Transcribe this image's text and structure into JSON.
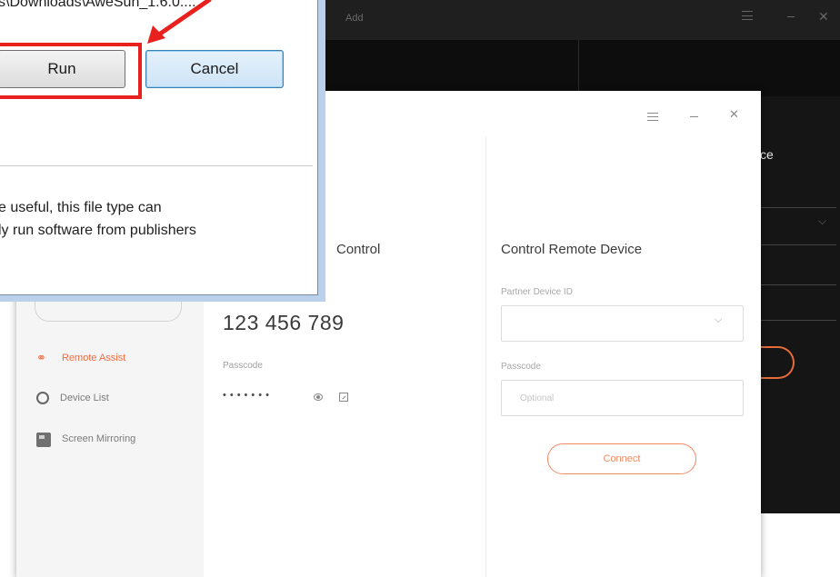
{
  "dark_app": {
    "title": "Add",
    "heading_fragment": "ce"
  },
  "app": {
    "sidebar": {
      "items": [
        {
          "label": "Remote Assist",
          "icon": "remote-assist-icon",
          "active": true
        },
        {
          "label": "Device List",
          "icon": "device-list-icon",
          "active": false
        },
        {
          "label": "Screen Mirroring",
          "icon": "screen-mirroring-icon",
          "active": false
        }
      ]
    },
    "allow_control": {
      "heading": "Control",
      "device_id": "123 456 789",
      "passcode_label": "Passcode",
      "passcode_masked": "•••••••"
    },
    "control_remote": {
      "heading": "Control Remote Device",
      "partner_label": "Partner Device ID",
      "partner_value": "",
      "passcode_label": "Passcode",
      "passcode_placeholder": "Optional",
      "connect_label": "Connect"
    }
  },
  "dialog": {
    "path_text": "s\\Downloads\\AweSun_1.6.0....",
    "run_label": "Run",
    "cancel_label": "Cancel",
    "warning_line1": "e useful, this file type can",
    "warning_line2": "ly run software from publishers"
  },
  "colors": {
    "accent": "#ef6d41",
    "annotation_red": "#e8201e",
    "dark_bg": "#151515"
  }
}
